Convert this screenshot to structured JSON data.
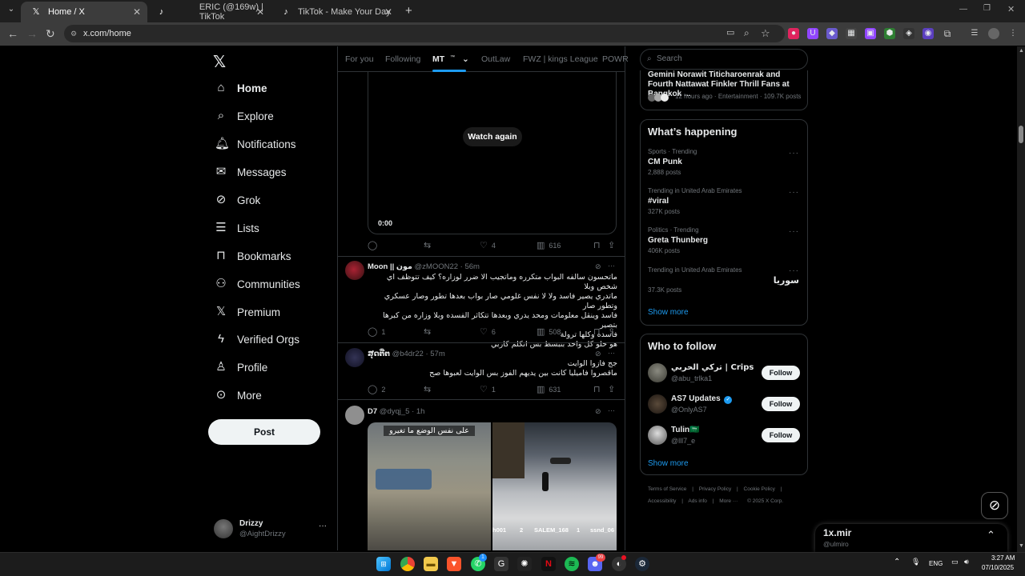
{
  "browser": {
    "tabs": [
      {
        "title": "Home / X",
        "icon": "x-logo-icon"
      },
      {
        "title": "ERIC (@169w) | TikTok",
        "icon": "tiktok-icon"
      },
      {
        "title": "TikTok - Make Your Day",
        "icon": "tiktok-icon"
      }
    ],
    "url": "x.com/home"
  },
  "sidebar": {
    "items": [
      {
        "label": "Home",
        "icon": "home-icon"
      },
      {
        "label": "Explore",
        "icon": "search-icon"
      },
      {
        "label": "Notifications",
        "icon": "bell-icon"
      },
      {
        "label": "Messages",
        "icon": "mail-icon"
      },
      {
        "label": "Grok",
        "icon": "grok-icon"
      },
      {
        "label": "Lists",
        "icon": "list-icon"
      },
      {
        "label": "Bookmarks",
        "icon": "bookmark-icon"
      },
      {
        "label": "Communities",
        "icon": "communities-icon"
      },
      {
        "label": "Premium",
        "icon": "x-icon"
      },
      {
        "label": "Verified Orgs",
        "icon": "lightning-icon"
      },
      {
        "label": "Profile",
        "icon": "person-icon"
      },
      {
        "label": "More",
        "icon": "more-circle-icon"
      }
    ],
    "post_label": "Post",
    "account": {
      "name": "Drizzy",
      "handle": "@AightDrizzy"
    }
  },
  "feed": {
    "tabs": [
      "For you",
      "Following",
      "MT",
      "OutLaw",
      "FWZ | kings League",
      "POWR"
    ],
    "mt_badge": "™",
    "video": {
      "watch_again": "Watch again",
      "time": "0:00"
    },
    "first_actions": {
      "replies": "",
      "reposts": "",
      "likes": "4",
      "views": "616"
    },
    "tweets": [
      {
        "name": "Moon || مون",
        "meta": "@zMOON22 · 56m",
        "lines": [
          "ماتحسون سالفه البواب متكرره وماتجيب الا ضرر لوزاره؟ كيف تتوظف اي شخص وبلا",
          "ماتدري يصير فاسد ولا لا نفس غلومي صار بواب بعدها تطور وصار عسكري وتطور صار",
          "فاسد وينقل معلومات ومحد يدري وبعدها تتكاثر الفسده وبلا وزاره من كبرها بتصير",
          "فاسده وكلها ترولة",
          "هو حلو كل واحد بنبسط بس انكلم كاربي"
        ],
        "replies": "1",
        "reposts": "",
        "likes": "6",
        "views": "508"
      },
      {
        "name": "ສຸດຕື່ຕ",
        "meta": "@b4dr22 · 57m",
        "lines": [
          "جج فازوا الوايت",
          "ماقصروا فاميليا كانت بين يديهم الفوز بس الوايت لعبوها صح"
        ],
        "replies": "2",
        "reposts": "",
        "likes": "1",
        "views": "631"
      },
      {
        "name": "D7",
        "meta": "@dyqj_5 · 1h",
        "media_caption": "على نفس الوضع ما تغيرو",
        "game_names": [
          "h001",
          "2",
          "SALEM_168",
          "1",
          "ssnd_06"
        ]
      }
    ]
  },
  "right": {
    "search_placeholder": "Search",
    "news": {
      "title": "Gemini Norawit Titicharoenrak and Fourth Nattawat Finkler Thrill Fans at Bangkok ...",
      "meta": "12 hours ago · Entertainment · 109.7K posts"
    },
    "happening": {
      "title": "What’s happening",
      "trends": [
        {
          "meta": "Sports · Trending",
          "name": "CM Punk",
          "count": "2,888 posts"
        },
        {
          "meta": "Trending in United Arab Emirates",
          "name": "#viral",
          "count": "327K posts"
        },
        {
          "meta": "Politics · Trending",
          "name": "Greta Thunberg",
          "count": "406K posts"
        },
        {
          "meta": "Trending in United Arab Emirates",
          "name": "سوريا",
          "count": "37.3K posts"
        }
      ],
      "show_more": "Show more"
    },
    "who_to_follow": {
      "title": "Who to follow",
      "users": [
        {
          "name": "تركي الحربي | Crips",
          "handle": "@abu_trlka1",
          "button": "Follow"
        },
        {
          "name": "AS7 Updates",
          "handle": "@OnlyAS7",
          "button": "Follow"
        },
        {
          "name": "Tulin🇸🇦",
          "handle": "@lll7_e",
          "button": "Follow"
        }
      ],
      "show_more": "Show more"
    },
    "footer": {
      "row1": [
        "Terms of Service",
        "|",
        "Privacy Policy",
        "|",
        "Cookie Policy",
        "|"
      ],
      "row2": [
        "Accessibility",
        "|",
        "Ads info",
        "|",
        "More ···",
        "© 2025 X Corp."
      ]
    }
  },
  "drawer": {
    "title": "1x.mir",
    "subtitle": "@ulmiro"
  },
  "taskbar": {
    "lang": "ENG",
    "time": "3:27 AM",
    "date": "07/10/2025",
    "discord_badge": "99",
    "whatsapp_badge": "1"
  },
  "colors": {
    "accent": "#1d9bf0",
    "bg": "#000000",
    "border": "#2f3336",
    "muted": "#71767b"
  }
}
